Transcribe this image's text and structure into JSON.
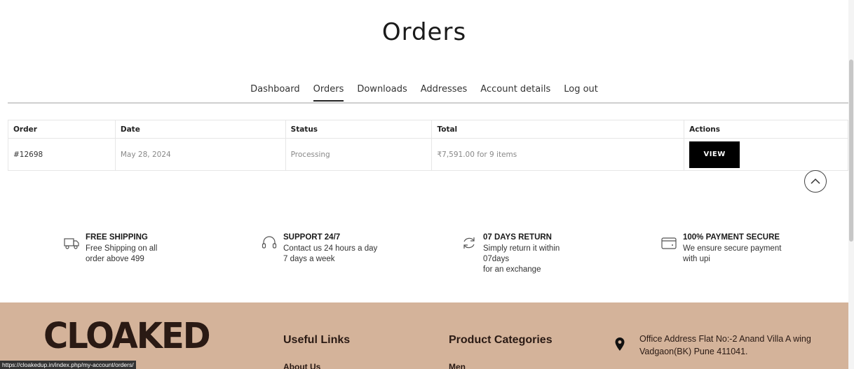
{
  "page": {
    "title": "Orders"
  },
  "nav": {
    "items": [
      {
        "label": "Dashboard"
      },
      {
        "label": "Orders"
      },
      {
        "label": "Downloads"
      },
      {
        "label": "Addresses"
      },
      {
        "label": "Account details"
      },
      {
        "label": "Log out"
      }
    ],
    "active": "Orders"
  },
  "orders": {
    "headers": [
      "Order",
      "Date",
      "Status",
      "Total",
      "Actions"
    ],
    "rows": [
      {
        "order": "#12698",
        "date": "May 28, 2024",
        "status": "Processing",
        "total": "₹7,591.00 for 9 items",
        "action": "VIEW"
      }
    ]
  },
  "features": [
    {
      "icon": "truck-icon",
      "title": "FREE SHIPPING",
      "desc": "Free Shipping on all\norder above 499"
    },
    {
      "icon": "headset-icon",
      "title": "SUPPORT 24/7",
      "desc": "Contact us 24 hours a day\n7 days a week"
    },
    {
      "icon": "return-icon",
      "title": "07 DAYS RETURN",
      "desc": "Simply return it within\n07days\nfor an exchange"
    },
    {
      "icon": "wallet-icon",
      "title": "100% PAYMENT SECURE",
      "desc": "We ensure secure payment\nwith upi"
    }
  ],
  "footer": {
    "logo_text": "CLOAKED",
    "useful_links_heading": "Useful Links",
    "useful_links": [
      "About Us"
    ],
    "categories_heading": "Product Categories",
    "categories": [
      "Men"
    ],
    "address": "Office Address Flat No:-2 Anand Villa A wing\nVadgaon(BK) Pune 411041."
  },
  "status_bar": {
    "url": "https://cloakedup.in/index.php/my-account/orders/"
  },
  "colors": {
    "footer_bg": "#d4b39a",
    "button_bg": "#000000",
    "accent_text": "#2a1a14"
  }
}
